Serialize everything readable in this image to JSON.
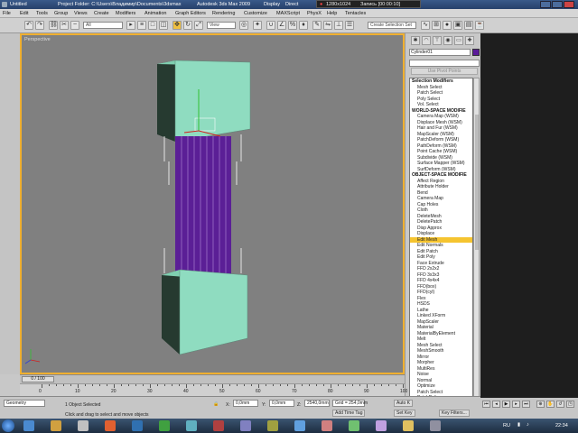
{
  "window": {
    "title_untitled": "Untitled",
    "project_folder": "Project Folder: C:\\Users\\Владимир\\Documents\\3dsmax",
    "app_title": "Autodesk 3ds Max 2009",
    "display_label": "Display",
    "direct_label": "Direct"
  },
  "recorder": {
    "resolution": "1280x1024",
    "status": "Запись [00:00:10]"
  },
  "menu": [
    "File",
    "Edit",
    "Tools",
    "Group",
    "Views",
    "Create",
    "Modifiers",
    "Animation",
    "Graph Editors",
    "Rendering",
    "Customize",
    "MAXScript",
    "PhysX",
    "Help",
    "Tentacles"
  ],
  "toolbar": {
    "filter_value": "All",
    "ref_coord_value": "View",
    "selection_set_placeholder": "Create Selection Set"
  },
  "viewport": {
    "label": "Perspective",
    "colors": {
      "pillar": "#5b1f96",
      "block": "#8fdcc0",
      "background": "#808080",
      "border": "#f0b030"
    }
  },
  "command_panel": {
    "object_name": "Cylinder01",
    "object_color": "#5a1a9a",
    "pin_button": "Use Pivot Points",
    "modifiers": [
      {
        "label": "Selection Modifiers",
        "header": true
      },
      {
        "label": "Mesh Select"
      },
      {
        "label": "Patch Select"
      },
      {
        "label": "Poly Select"
      },
      {
        "label": "Vol. Select"
      },
      {
        "label": "WORLD-SPACE MODIFIE",
        "header": true
      },
      {
        "label": "Camera Map (WSM)"
      },
      {
        "label": "Displace Mesh (WSM)"
      },
      {
        "label": "Hair and Fur (WSM)"
      },
      {
        "label": "MapScaler (WSM)"
      },
      {
        "label": "PatchDeform (WSM)"
      },
      {
        "label": "PathDeform (WSM)"
      },
      {
        "label": "Point Cache (WSM)"
      },
      {
        "label": "Subdivide (WSM)"
      },
      {
        "label": "Surface Mapper (WSM)"
      },
      {
        "label": "SurfDeform (WSM)"
      },
      {
        "label": "OBJECT-SPACE MODIFIE",
        "header": true
      },
      {
        "label": "Affect Region"
      },
      {
        "label": "Attribute Holder"
      },
      {
        "label": "Bend"
      },
      {
        "label": "Camera Map"
      },
      {
        "label": "Cap Holes"
      },
      {
        "label": "Cloth"
      },
      {
        "label": "DeleteMesh"
      },
      {
        "label": "DeletePatch"
      },
      {
        "label": "Disp Approx"
      },
      {
        "label": "Displace"
      },
      {
        "label": "Edit Mesh",
        "selected": true
      },
      {
        "label": "Edit Normals"
      },
      {
        "label": "Edit Patch"
      },
      {
        "label": "Edit Poly"
      },
      {
        "label": "Face Extrude"
      },
      {
        "label": "FFD 2x2x2"
      },
      {
        "label": "FFD 3x3x3"
      },
      {
        "label": "FFD 4x4x4"
      },
      {
        "label": "FFD(box)"
      },
      {
        "label": "FFD(cyl)"
      },
      {
        "label": "Flex"
      },
      {
        "label": "HSDS"
      },
      {
        "label": "Lathe"
      },
      {
        "label": "Linked XForm"
      },
      {
        "label": "MapScaler"
      },
      {
        "label": "Material"
      },
      {
        "label": "MaterialByElement"
      },
      {
        "label": "Melt"
      },
      {
        "label": "Mesh Select"
      },
      {
        "label": "MeshSmooth"
      },
      {
        "label": "Mirror"
      },
      {
        "label": "Morpher"
      },
      {
        "label": "MultiRes"
      },
      {
        "label": "Noise"
      },
      {
        "label": "Normal"
      },
      {
        "label": "Optimize"
      },
      {
        "label": "Patch Select"
      },
      {
        "label": "PatchDeform"
      }
    ]
  },
  "timeline": {
    "slider_label": "0 / 100",
    "progress": 0,
    "ticks": [
      "0",
      "10",
      "20",
      "30",
      "40",
      "50",
      "60",
      "70",
      "80",
      "90",
      "100"
    ]
  },
  "status": {
    "selection_count": "1 Object Selected",
    "prompt": "Click and drag to select and move objects",
    "listener": "Geometry",
    "x_label": "X:",
    "x_value": "0,0mm",
    "y_label": "Y:",
    "y_value": "0,0mm",
    "z_label": "Z:",
    "z_value": "2540,0mm",
    "grid_value": "Grid = 254,0mm",
    "add_time_tag": "Add Time Tag",
    "auto_key": "Auto K",
    "set_key": "Set Key",
    "key_filters": "Key Filters..."
  },
  "taskbar": {
    "language": "RU",
    "clock": "22:34"
  }
}
